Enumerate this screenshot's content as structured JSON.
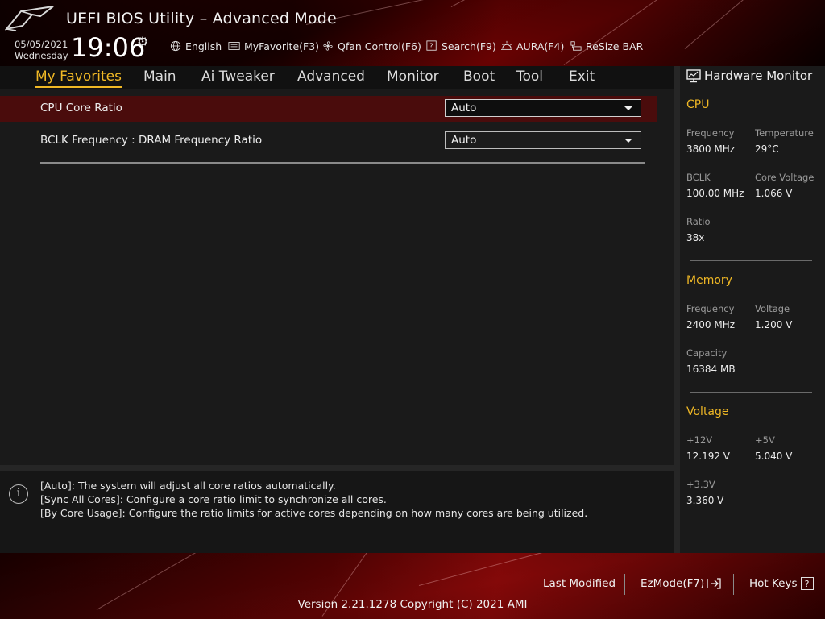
{
  "header": {
    "title": "UEFI BIOS Utility – Advanced Mode",
    "date": "05/05/2021",
    "day": "Wednesday",
    "time": "19:06",
    "toolbar": [
      {
        "label": "English",
        "icon": "globe-icon"
      },
      {
        "label": "MyFavorite(F3)",
        "icon": "favorite-icon"
      },
      {
        "label": "Qfan Control(F6)",
        "icon": "fan-icon"
      },
      {
        "label": "Search(F9)",
        "icon": "search-icon"
      },
      {
        "label": "AURA(F4)",
        "icon": "aura-icon"
      },
      {
        "label": "ReSize BAR",
        "icon": "resize-bar-icon"
      }
    ]
  },
  "nav": {
    "tabs": [
      {
        "label": "My Favorites",
        "active": true
      },
      {
        "label": "Main"
      },
      {
        "label": "Ai Tweaker"
      },
      {
        "label": "Advanced"
      },
      {
        "label": "Monitor"
      },
      {
        "label": "Boot"
      },
      {
        "label": "Tool"
      },
      {
        "label": "Exit"
      }
    ]
  },
  "settings": [
    {
      "label": "CPU Core Ratio",
      "value": "Auto",
      "selected": true
    },
    {
      "label": "BCLK Frequency : DRAM Frequency Ratio",
      "value": "Auto"
    }
  ],
  "help": {
    "lines": [
      "[Auto]: The system will adjust all core ratios automatically.",
      "[Sync All Cores]: Configure a core ratio limit to synchronize all cores.",
      "[By Core Usage]: Configure the ratio limits for active cores depending on how many cores are being utilized."
    ]
  },
  "hardware_monitor": {
    "title": "Hardware Monitor",
    "cpu": {
      "heading": "CPU",
      "frequency_label": "Frequency",
      "frequency": "3800 MHz",
      "temperature_label": "Temperature",
      "temperature": "29°C",
      "bclk_label": "BCLK",
      "bclk": "100.00 MHz",
      "core_voltage_label": "Core Voltage",
      "core_voltage": "1.066 V",
      "ratio_label": "Ratio",
      "ratio": "38x"
    },
    "memory": {
      "heading": "Memory",
      "frequency_label": "Frequency",
      "frequency": "2400 MHz",
      "voltage_label": "Voltage",
      "voltage": "1.200 V",
      "capacity_label": "Capacity",
      "capacity": "16384 MB"
    },
    "voltage": {
      "heading": "Voltage",
      "v12_label": "+12V",
      "v12": "12.192 V",
      "v5_label": "+5V",
      "v5": "5.040 V",
      "v33_label": "+3.3V",
      "v33": "3.360 V"
    }
  },
  "footer": {
    "last_modified": "Last Modified",
    "ezmode": "EzMode(F7)",
    "hotkeys": "Hot Keys",
    "hotkeys_key": "?",
    "version": "Version 2.21.1278 Copyright (C) 2021 AMI"
  },
  "colors": {
    "accent": "#f0b825",
    "selected_row": "#4a0c0c",
    "brand_red": "#7a0808"
  }
}
